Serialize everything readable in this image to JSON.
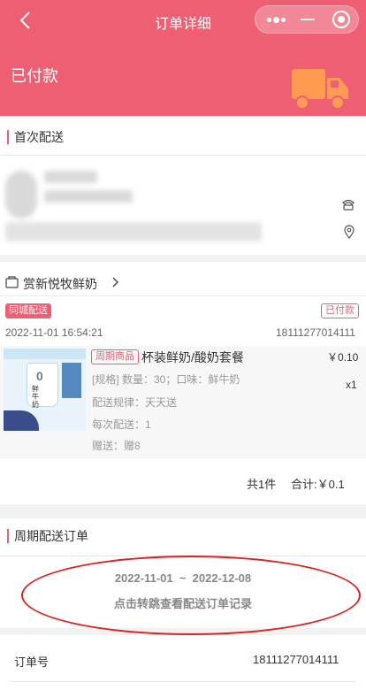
{
  "nav": {
    "title": "订单详细"
  },
  "order": {
    "status": "已付款"
  },
  "delivery": {
    "section_title": "首次配送"
  },
  "shop": {
    "name": "赏新悦牧鲜奶"
  },
  "product": {
    "delivery_tag": "同城配送",
    "pay_status": "已付款",
    "order_time": "2022-11-01 16:54:21",
    "order_no": "18111277014111",
    "period_tag": "周期商品",
    "name": "杯装鲜奶/酸奶套餐",
    "price": "￥0.10",
    "qty": "x1",
    "spec": "[规格] 数量：30；口味：鲜牛奶",
    "rule": "配送规律：天天送",
    "per": "每次配送：1",
    "gift": "赠送：赠8",
    "cup_text": "鲜牛奶"
  },
  "totals": {
    "count": "共1件",
    "amount": "合计:￥0.1"
  },
  "period": {
    "section_title": "周期配送订单",
    "date_range": "2022-11-01  ~  2022-12-08",
    "link": "点击转跳查看配送订单记录"
  },
  "info": {
    "order_no_label": "订单号",
    "order_no": "18111277014111"
  },
  "colors": {
    "accent": "#ee5f73",
    "truck": "#ff9a52",
    "annotation": "#e02020"
  }
}
